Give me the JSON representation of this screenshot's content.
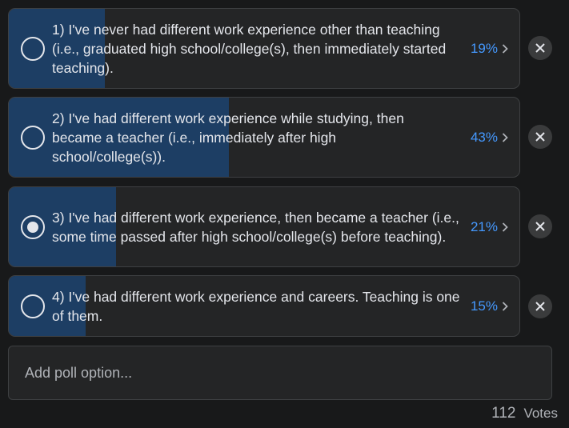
{
  "options": [
    {
      "label": "1) I've never had different work experience other than teaching (i.e., graduated high school/college(s), then immediately started teaching).",
      "percent_text": "19%",
      "percent": 19,
      "selected": false
    },
    {
      "label": "2) I've had different work experience while studying, then became a teacher (i.e., immediately after high school/college(s)).",
      "percent_text": "43%",
      "percent": 43,
      "selected": false
    },
    {
      "label": "3) I've had different work experience, then became a teacher (i.e., some time passed after high school/college(s) before teaching).",
      "percent_text": "21%",
      "percent": 21,
      "selected": true
    },
    {
      "label": "4) I've had different work experience and careers. Teaching is one of them.",
      "percent_text": "15%",
      "percent": 15,
      "selected": false
    }
  ],
  "add_option": {
    "placeholder": "Add poll option..."
  },
  "votes": {
    "count": "112",
    "label": "Votes"
  },
  "colors": {
    "fill": "#1d3e64",
    "percent": "#4599ff",
    "background": "#18191a"
  },
  "icons": {
    "remove": "close-icon",
    "more": "chevron-right-icon"
  }
}
